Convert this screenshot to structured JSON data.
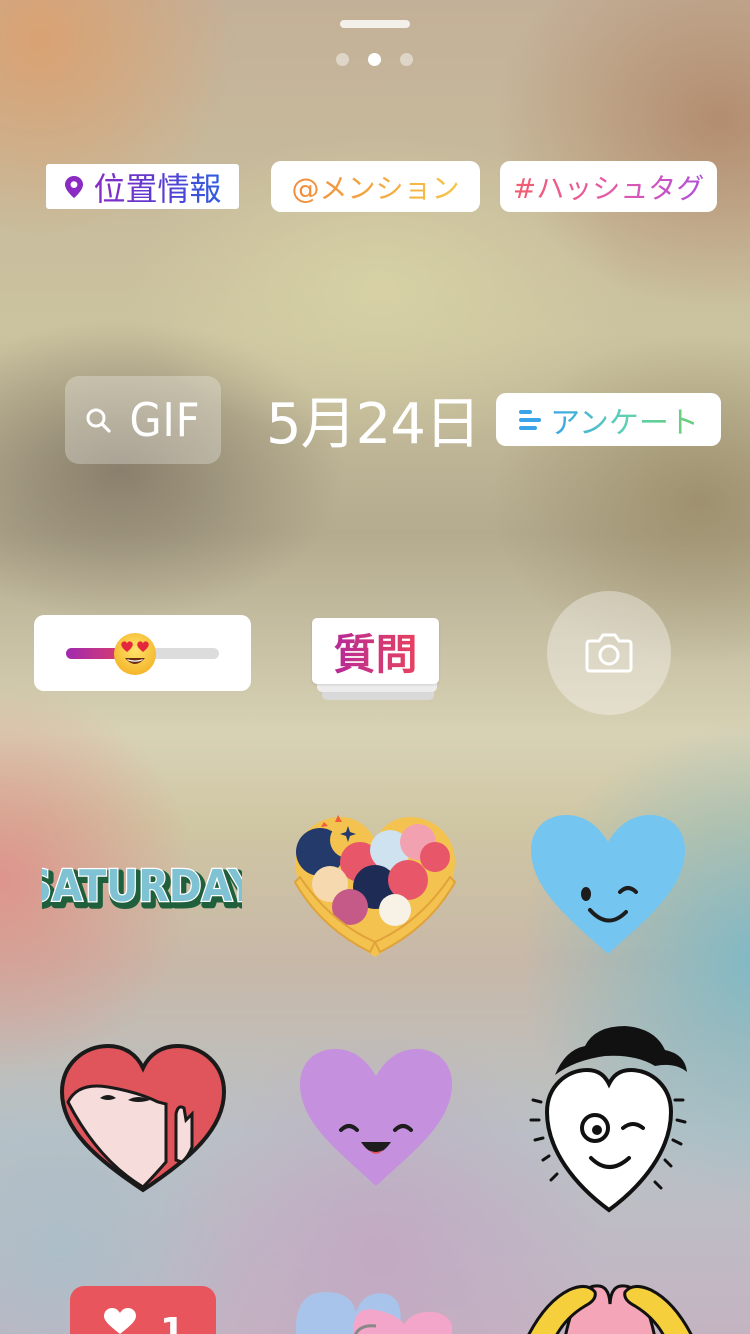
{
  "pager": {
    "page_count": 3,
    "active_index": 1
  },
  "quick_stickers": {
    "location": {
      "label": "位置情報",
      "icon": "location-pin-icon"
    },
    "mention": {
      "label": "@メンション"
    },
    "hashtag": {
      "label": "#ハッシュタグ"
    },
    "gif": {
      "label": "GIF",
      "icon": "search-icon"
    },
    "date": {
      "label": "5月24日"
    },
    "poll": {
      "label": "アンケート",
      "icon": "poll-bars-icon"
    },
    "emoji_slider": {
      "value": 0.45,
      "emoji": "heart-eyes-emoji"
    },
    "question": {
      "label": "質問"
    },
    "camera": {
      "icon": "camera-icon"
    }
  },
  "gif_stickers": {
    "saturday": {
      "label": "SATURDAY"
    },
    "like_counter": {
      "count": "1"
    }
  },
  "colors": {
    "location_gradient": [
      "#8b2bc4",
      "#2d5fe0"
    ],
    "mention_gradient": [
      "#f08a3b",
      "#f6c64a"
    ],
    "hashtag_gradient": [
      "#f25d6f",
      "#b14fd8"
    ],
    "poll_gradient": [
      "#3aa4e8",
      "#6acd72"
    ],
    "question_gradient": [
      "#b52a98",
      "#e8425e"
    ]
  }
}
